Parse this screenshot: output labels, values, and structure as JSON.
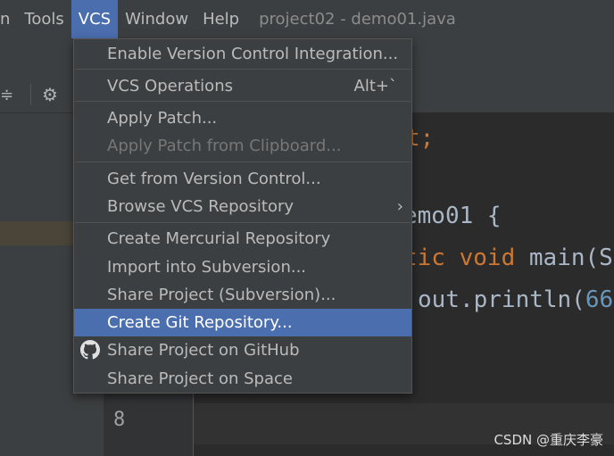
{
  "menubar": {
    "items": [
      "n",
      "Tools",
      "VCS",
      "Window",
      "Help"
    ],
    "title": "project02 - demo01.java"
  },
  "vcs_menu": {
    "enable": "Enable Version Control Integration...",
    "operations": "VCS Operations",
    "operations_shortcut": "Alt+`",
    "apply_patch": "Apply Patch...",
    "apply_patch_clipboard": "Apply Patch from Clipboard...",
    "get_from_vc": "Get from Version Control...",
    "browse_repo": "Browse VCS Repository",
    "create_mercurial": "Create Mercurial Repository",
    "import_svn": "Import into Subversion...",
    "share_svn": "Share Project (Subversion)...",
    "create_git": "Create Git Repository...",
    "share_github": "Share Project on GitHub",
    "share_space": "Share Project on Space"
  },
  "editor": {
    "line1": "t;",
    "line2_tail": "emo01 {",
    "line3_kw1": "tic",
    "line3_kw2": "void",
    "line3_rest": "main(S",
    "line4_a": "out.println(",
    "line4_num": "66",
    "line_number": "8"
  },
  "watermark": "CSDN @重庆李豪"
}
